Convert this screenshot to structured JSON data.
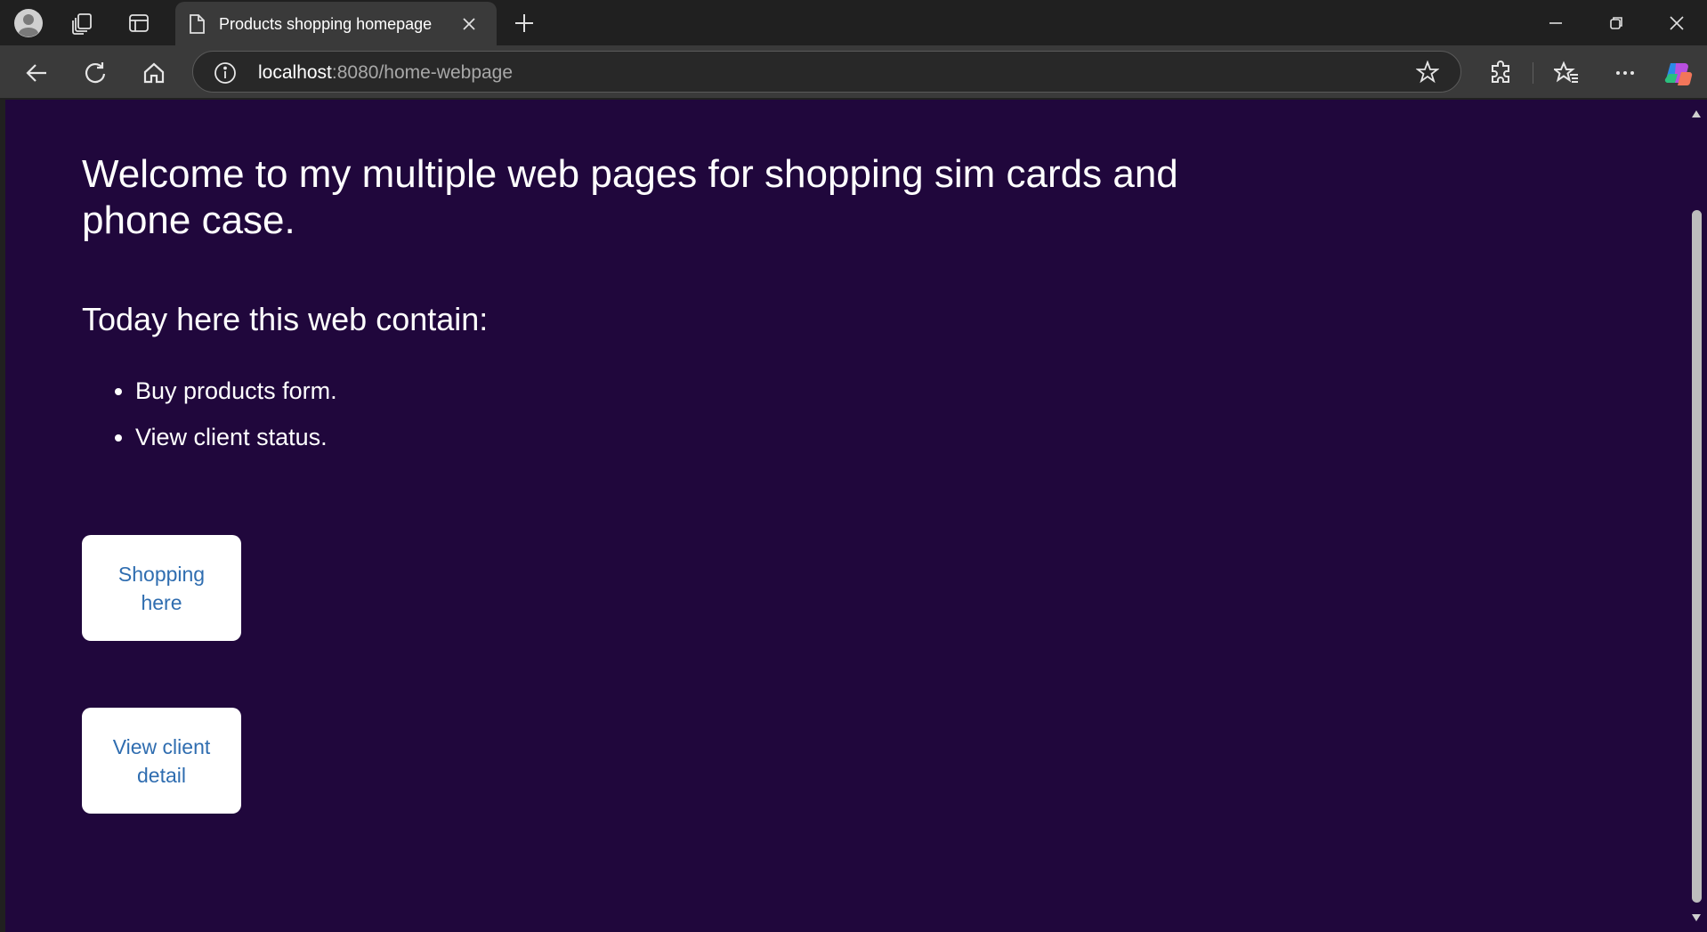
{
  "tab": {
    "title": "Products shopping homepage"
  },
  "address_bar": {
    "host": "localhost",
    "rest": ":8080/home-webpage"
  },
  "page": {
    "heading": "Welcome to my multiple web pages for shopping sim cards and phone case.",
    "subheading": "Today here this web contain:",
    "features": [
      "Buy products form.",
      "View client status."
    ],
    "buttons": {
      "shopping": "Shopping here",
      "view_client": "View client detail"
    }
  },
  "colors": {
    "page_background": "#20073c",
    "button_text": "#2f6db0",
    "button_background": "#ffffff"
  },
  "icons": {
    "tabstrip": [
      "profile-avatar-icon",
      "workspaces-icon",
      "vertical-tabs-icon",
      "new-tab-icon"
    ],
    "tab": [
      "page-favicon-icon",
      "tab-close-icon"
    ],
    "window": [
      "minimize-icon",
      "restore-icon",
      "window-close-icon"
    ],
    "toolbar": [
      "back-icon",
      "refresh-icon",
      "home-icon",
      "site-info-icon",
      "favorite-star-icon",
      "extensions-icon",
      "favorites-icon",
      "more-menu-icon",
      "copilot-icon"
    ]
  }
}
